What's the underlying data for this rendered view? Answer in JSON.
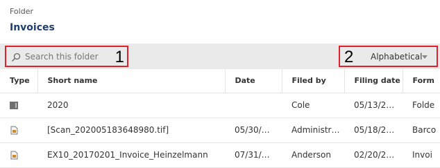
{
  "breadcrumb": "Folder",
  "page_title": "Invoices",
  "search": {
    "placeholder": "Search this folder",
    "callout": "1"
  },
  "sort": {
    "label": "Alphabetical",
    "callout": "2"
  },
  "columns": [
    "Type",
    "Short name",
    "Date",
    "Filed by",
    "Filing date",
    "Form"
  ],
  "rows": [
    {
      "type_icon": "folder-icon",
      "name": "2020",
      "date": "",
      "filed_by": "Cole",
      "filing_date": "05/13/2…",
      "form": "Folde"
    },
    {
      "type_icon": "document-icon",
      "name": "[Scan_202005183648980.tif]",
      "date": "05/30/…",
      "filed_by": "Administr…",
      "filing_date": "05/18/2…",
      "form": "Barco"
    },
    {
      "type_icon": "document-icon",
      "name": "EX10_20170201_Invoice_Heinzelmann",
      "date": "07/31/…",
      "filed_by": "Anderson",
      "filing_date": "02/20/2…",
      "form": "Invoi"
    }
  ]
}
